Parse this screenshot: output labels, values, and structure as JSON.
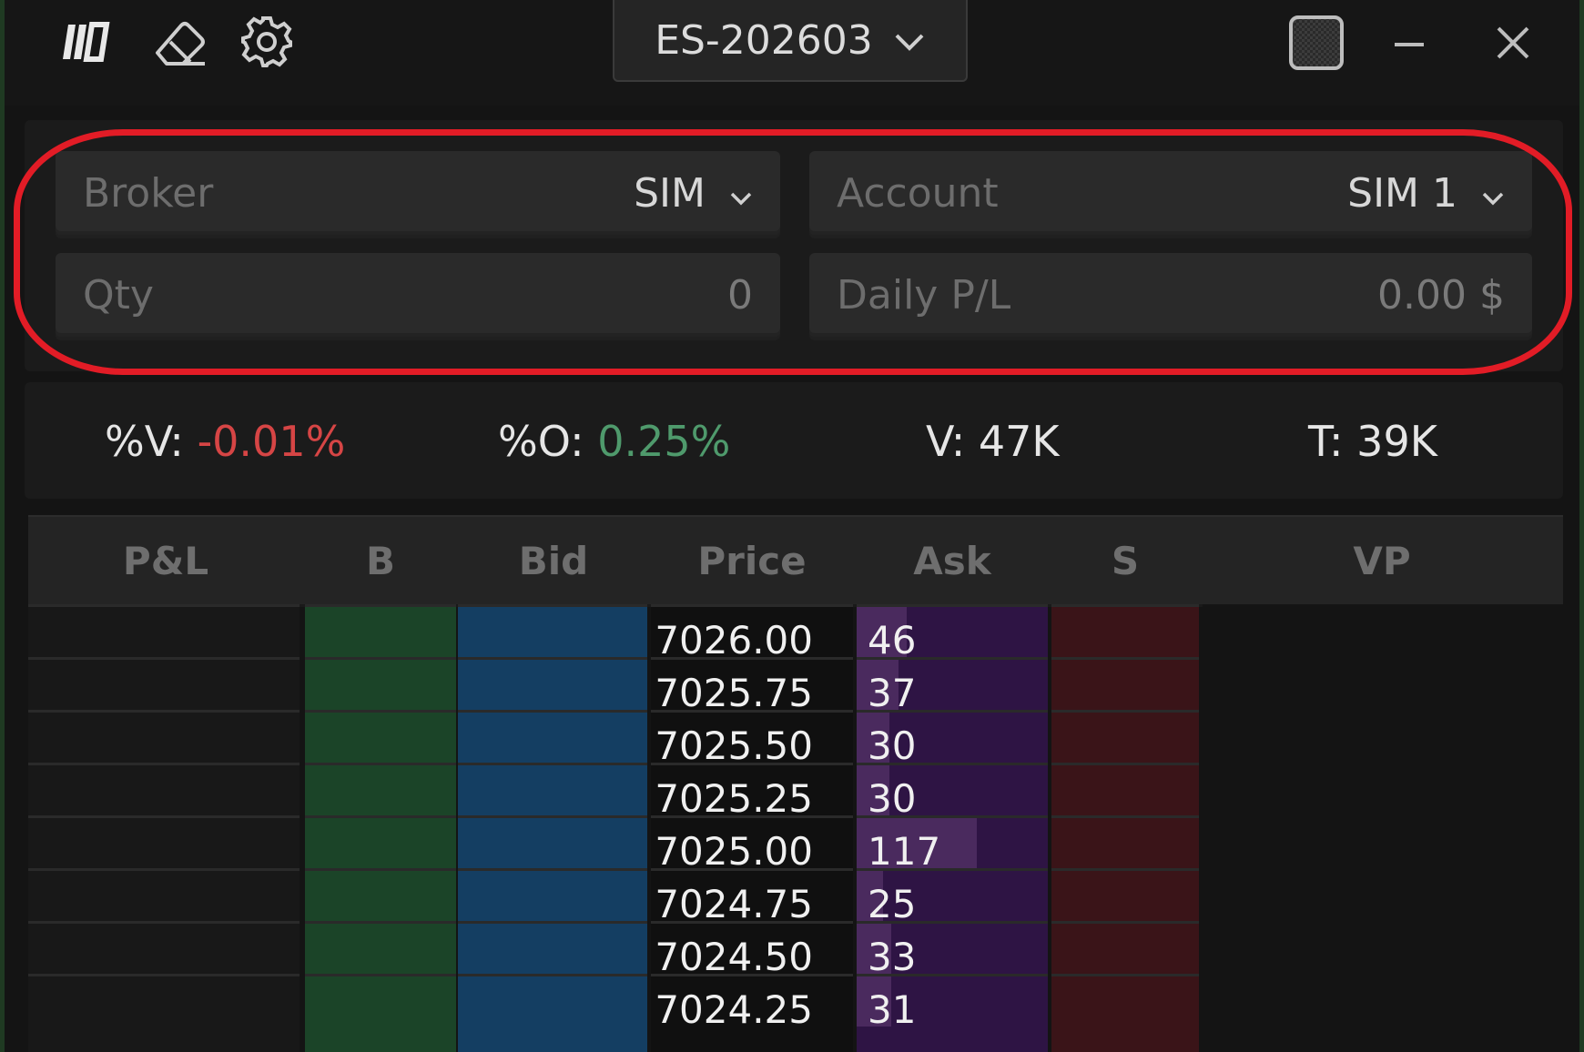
{
  "app": {
    "contract": "ES-202603"
  },
  "account_panel": {
    "broker": {
      "label": "Broker",
      "value": "SIM"
    },
    "account": {
      "label": "Account",
      "value": "SIM 1"
    },
    "qty": {
      "label": "Qty",
      "value": "0"
    },
    "daily_pl": {
      "label": "Daily P/L",
      "value": "0.00 $"
    }
  },
  "stats": {
    "v_pct": {
      "label": "%V:",
      "value": "-0.01%"
    },
    "o_pct": {
      "label": "%O:",
      "value": "0.25%"
    },
    "volume": {
      "label": "V:",
      "value": "47K"
    },
    "trades": {
      "label": "T:",
      "value": "39K"
    }
  },
  "ladder": {
    "columns": [
      "P&L",
      "B",
      "Bid",
      "Price",
      "Ask",
      "S",
      "VP"
    ],
    "rows": [
      {
        "price": "7026.00",
        "ask": "46",
        "ask_fill": 0.26
      },
      {
        "price": "7025.75",
        "ask": "37",
        "ask_fill": 0.22
      },
      {
        "price": "7025.50",
        "ask": "30",
        "ask_fill": 0.17
      },
      {
        "price": "7025.25",
        "ask": "30",
        "ask_fill": 0.17
      },
      {
        "price": "7025.00",
        "ask": "117",
        "ask_fill": 0.63
      },
      {
        "price": "7024.75",
        "ask": "25",
        "ask_fill": 0.14
      },
      {
        "price": "7024.50",
        "ask": "33",
        "ask_fill": 0.18
      },
      {
        "price": "7024.25",
        "ask": "31",
        "ask_fill": 0.18
      }
    ]
  },
  "colors": {
    "b_col": "#1b4428",
    "bid_col": "#143e62",
    "ask_col": "#2e1444",
    "s_col": "#3a1418",
    "highlight": "#e21c26"
  },
  "icons": [
    "logo-icon",
    "eraser-icon",
    "gear-icon",
    "chevron-down-icon",
    "window-grid-icon",
    "minimize-icon",
    "close-icon"
  ]
}
